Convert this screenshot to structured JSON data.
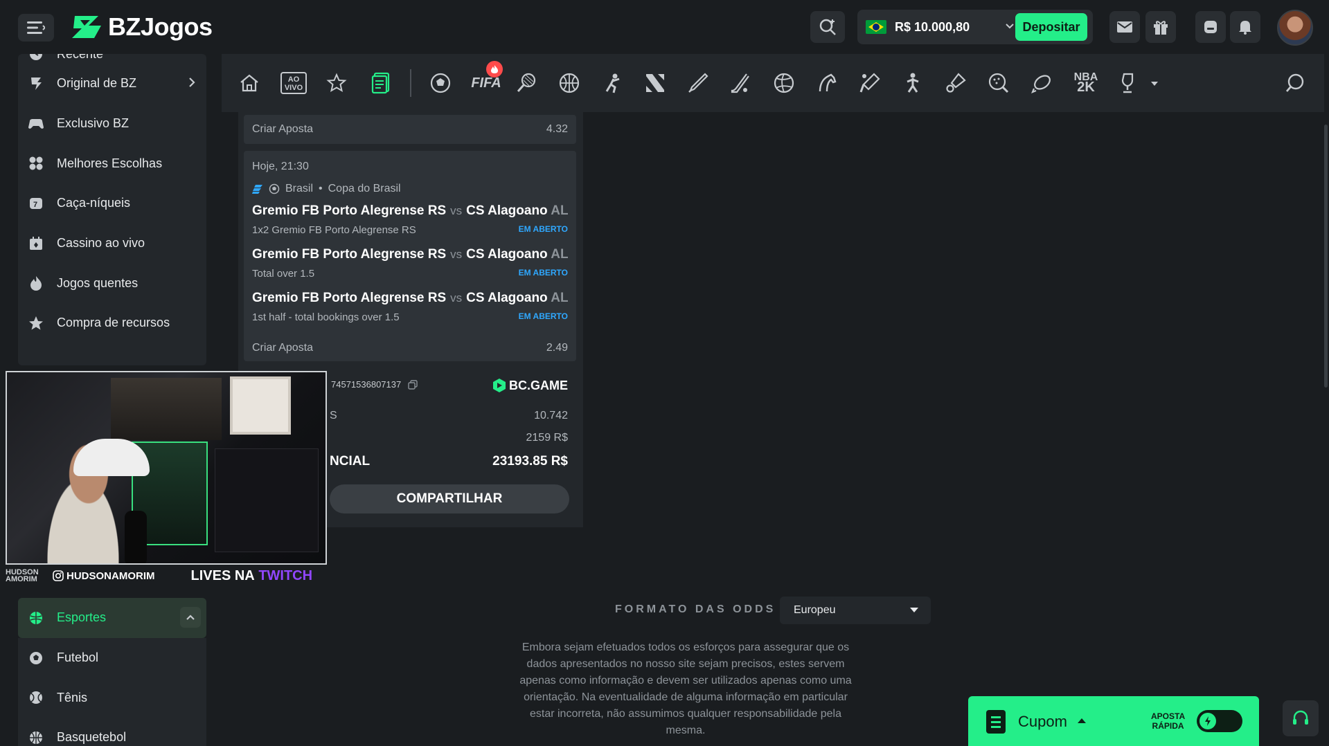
{
  "header": {
    "brand": "BZJogos",
    "balance": "R$ 10.000,80",
    "deposit_label": "Depositar"
  },
  "sidebar": {
    "items": [
      {
        "label": "Recente",
        "icon": "clock-icon"
      },
      {
        "label": "Original de BZ",
        "icon": "bz-original-icon"
      },
      {
        "label": "Exclusivo BZ",
        "icon": "controller-icon"
      },
      {
        "label": "Melhores Escolhas",
        "icon": "grid-icon"
      },
      {
        "label": "Caça-níqueis",
        "icon": "slot-icon"
      },
      {
        "label": "Cassino ao vivo",
        "icon": "live-casino-icon"
      },
      {
        "label": "Jogos quentes",
        "icon": "fire-icon"
      },
      {
        "label": "Compra de recursos",
        "icon": "star-icon"
      }
    ],
    "sports": [
      {
        "label": "Esportes",
        "icon": "sports-icon",
        "active": true
      },
      {
        "label": "Futebol",
        "icon": "soccer-icon"
      },
      {
        "label": "Tênis",
        "icon": "tennis-icon"
      },
      {
        "label": "Basquetebol",
        "icon": "basketball-icon"
      }
    ]
  },
  "stream_overlay": {
    "name_tag": "HUDSON AMORIM",
    "instagram": "HUDSONAMORIM",
    "lives_prefix": "LIVES NA",
    "lives_platform": "TWITCH"
  },
  "sports_nav": {
    "live_label": "AO VIVO",
    "fifa_label": "FIFA",
    "nba_label": "NBA"
  },
  "bet_slip": {
    "top_row": {
      "label": "Criar Aposta",
      "odds": "4.32"
    },
    "combo": {
      "datetime": "Hoje, 21:30",
      "country": "Brasil",
      "competition": "Copa do Brasil",
      "legs": [
        {
          "home": "Gremio FB Porto Alegrense RS",
          "vs": "vs",
          "away": "CS Alagoano",
          "away_tail": "AL",
          "market": "1x2 Gremio FB Porto Alegrense RS",
          "status": "EM ABERTO"
        },
        {
          "home": "Gremio FB Porto Alegrense RS",
          "vs": "vs",
          "away": "CS Alagoano",
          "away_tail": "AL",
          "market": "Total over 1.5",
          "status": "EM ABERTO"
        },
        {
          "home": "Gremio FB Porto Alegrense RS",
          "vs": "vs",
          "away": "CS Alagoano",
          "away_tail": "AL",
          "market": "1st half - total bookings over 1.5",
          "status": "EM ABERTO"
        }
      ],
      "bottom_row": {
        "label": "Criar Aposta",
        "odds": "2.49"
      }
    },
    "bet_id": "745715368071​37",
    "provider": "BC.GAME",
    "odds_row": {
      "label": "S",
      "value": "10.742"
    },
    "stake_row": {
      "label": "",
      "value": "2159 R$"
    },
    "potential_row": {
      "label": "NCIAL",
      "value": "23193.85 R$"
    },
    "share_label": "COMPARTILHAR"
  },
  "odds_format": {
    "label": "FORMATO DAS ODDS",
    "selected": "Europeu"
  },
  "disclaimer": "Embora sejam efetuados todos os esforços para assegurar que os dados apresentados no nosso site sejam precisos, estes servem apenas como informação e devem ser utilizados apenas como uma orientação. Na eventualidade de alguma informação em particular estar incorreta, não assumimos qualquer responsabilidade pela mesma.",
  "coupon": {
    "label": "Cupom",
    "quick_bet_line1": "APOSTA",
    "quick_bet_line2": "RÁPIDA"
  },
  "colors": {
    "accent": "#24ee89",
    "background": "#1a1d20",
    "panel": "#23272b",
    "status_blue": "#2fa8ff",
    "twitch": "#9146ff"
  }
}
